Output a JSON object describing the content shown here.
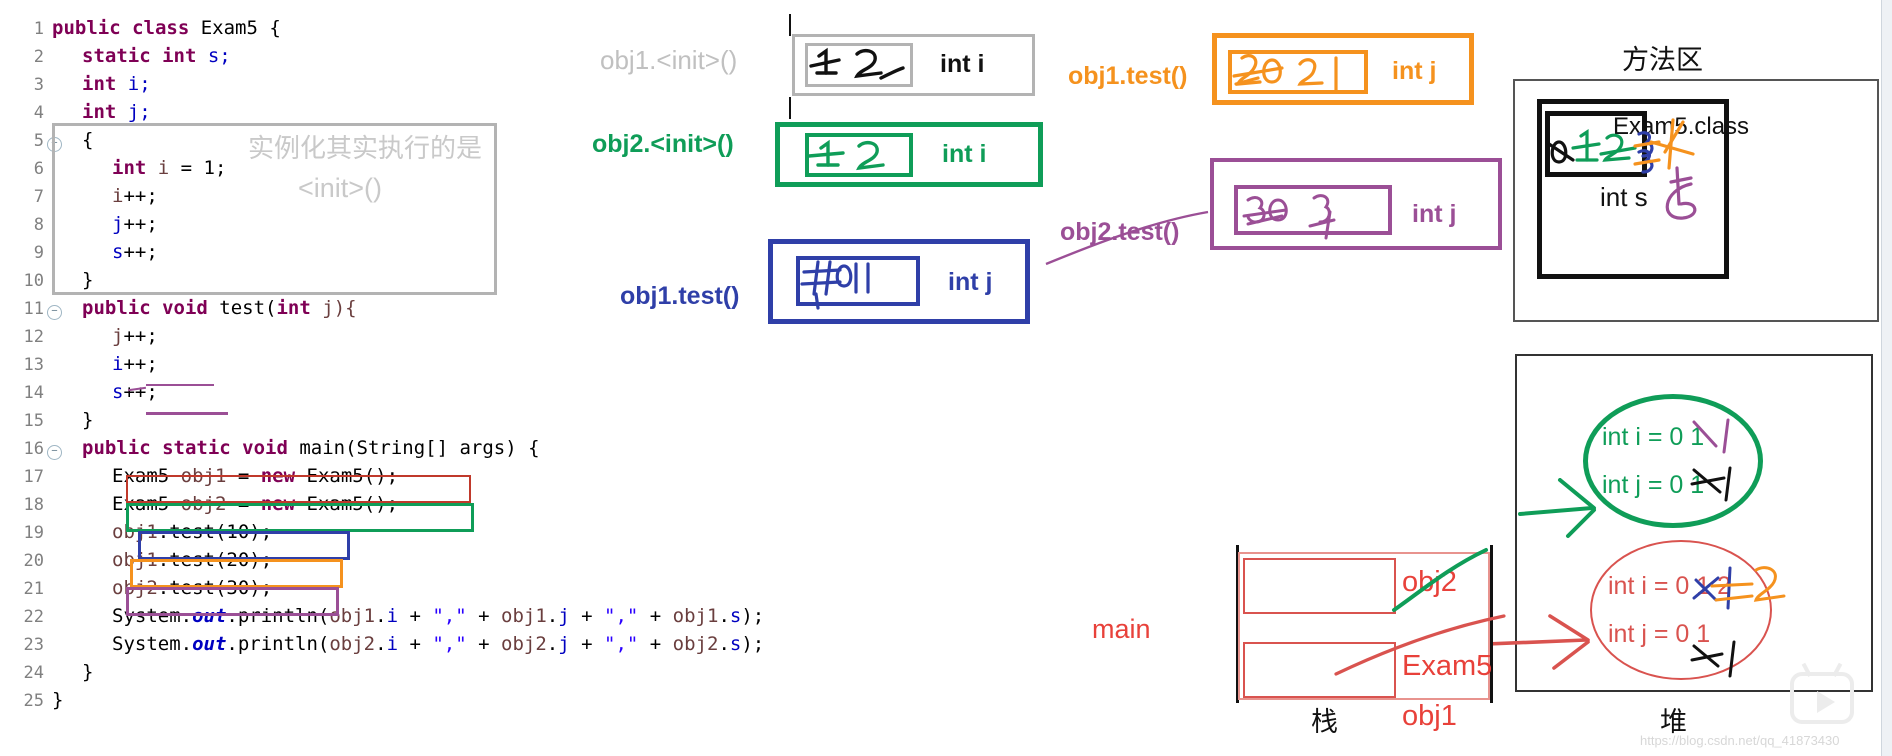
{
  "editor": {
    "lines": [
      {
        "n": "1",
        "indent": 0,
        "segments": [
          {
            "t": "public class ",
            "c": "kw"
          },
          {
            "t": "Exam5 {",
            "c": "plain"
          }
        ]
      },
      {
        "n": "2",
        "indent": 1,
        "segments": [
          {
            "t": "static int ",
            "c": "kw"
          },
          {
            "t": "s;",
            "c": "fld"
          }
        ]
      },
      {
        "n": "3",
        "indent": 1,
        "segments": [
          {
            "t": "int ",
            "c": "kw"
          },
          {
            "t": "i;",
            "c": "fld"
          }
        ]
      },
      {
        "n": "4",
        "indent": 1,
        "segments": [
          {
            "t": "int ",
            "c": "kw"
          },
          {
            "t": "j;",
            "c": "fld"
          }
        ]
      },
      {
        "n": "5",
        "indent": 1,
        "fold": true,
        "segments": [
          {
            "t": "{",
            "c": "plain"
          }
        ]
      },
      {
        "n": "6",
        "indent": 2,
        "segments": [
          {
            "t": "int ",
            "c": "kw"
          },
          {
            "t": "i",
            "c": "loc"
          },
          {
            "t": " = 1;",
            "c": "plain"
          }
        ]
      },
      {
        "n": "7",
        "indent": 2,
        "segments": [
          {
            "t": "i",
            "c": "loc"
          },
          {
            "t": "++;",
            "c": "plain"
          }
        ]
      },
      {
        "n": "8",
        "indent": 2,
        "segments": [
          {
            "t": "j",
            "c": "fld"
          },
          {
            "t": "++;",
            "c": "plain"
          }
        ]
      },
      {
        "n": "9",
        "indent": 2,
        "segments": [
          {
            "t": "s",
            "c": "fld"
          },
          {
            "t": "++;",
            "c": "plain"
          }
        ]
      },
      {
        "n": "10",
        "indent": 1,
        "segments": [
          {
            "t": "}",
            "c": "plain"
          }
        ]
      },
      {
        "n": "11",
        "indent": 1,
        "fold": true,
        "segments": [
          {
            "t": "public void ",
            "c": "kw"
          },
          {
            "t": "test(",
            "c": "plain"
          },
          {
            "t": "int ",
            "c": "kw"
          },
          {
            "t": "j){",
            "c": "loc"
          }
        ]
      },
      {
        "n": "12",
        "indent": 2,
        "segments": [
          {
            "t": "j",
            "c": "loc"
          },
          {
            "t": "++;",
            "c": "plain"
          }
        ]
      },
      {
        "n": "13",
        "indent": 2,
        "segments": [
          {
            "t": "i",
            "c": "fld"
          },
          {
            "t": "++;",
            "c": "plain"
          }
        ]
      },
      {
        "n": "14",
        "indent": 2,
        "segments": [
          {
            "t": "s",
            "c": "fld"
          },
          {
            "t": "++;",
            "c": "plain"
          }
        ]
      },
      {
        "n": "15",
        "indent": 1,
        "segments": [
          {
            "t": "}",
            "c": "plain"
          }
        ]
      },
      {
        "n": "16",
        "indent": 1,
        "fold": true,
        "segments": [
          {
            "t": "public static void ",
            "c": "kw"
          },
          {
            "t": "main(String[] args) {",
            "c": "plain"
          }
        ]
      },
      {
        "n": "17",
        "indent": 2,
        "segments": [
          {
            "t": "Exam5 ",
            "c": "plain"
          },
          {
            "t": "obj1",
            "c": "loc"
          },
          {
            "t": " = ",
            "c": "plain"
          },
          {
            "t": "new ",
            "c": "kw"
          },
          {
            "t": "Exam5();",
            "c": "plain"
          }
        ]
      },
      {
        "n": "18",
        "indent": 2,
        "segments": [
          {
            "t": "Exam5 ",
            "c": "plain"
          },
          {
            "t": "obj2",
            "c": "loc"
          },
          {
            "t": " = ",
            "c": "plain"
          },
          {
            "t": "new ",
            "c": "kw"
          },
          {
            "t": "Exam5();",
            "c": "plain"
          }
        ]
      },
      {
        "n": "19",
        "indent": 2,
        "segments": [
          {
            "t": "obj1",
            "c": "loc"
          },
          {
            "t": ".test(10);",
            "c": "plain"
          }
        ]
      },
      {
        "n": "20",
        "indent": 2,
        "segments": [
          {
            "t": "obj1",
            "c": "loc"
          },
          {
            "t": ".test(20);",
            "c": "plain"
          }
        ]
      },
      {
        "n": "21",
        "indent": 2,
        "segments": [
          {
            "t": "obj2",
            "c": "loc"
          },
          {
            "t": ".test(30);",
            "c": "plain"
          }
        ]
      },
      {
        "n": "22",
        "indent": 2,
        "segments": [
          {
            "t": "System.",
            "c": "plain"
          },
          {
            "t": "out",
            "c": "italicf"
          },
          {
            "t": ".println(",
            "c": "plain"
          },
          {
            "t": "obj1",
            "c": "loc"
          },
          {
            "t": ".",
            "c": "plain"
          },
          {
            "t": "i",
            "c": "fld"
          },
          {
            "t": " + ",
            "c": "plain"
          },
          {
            "t": "\",\"",
            "c": "st"
          },
          {
            "t": " + ",
            "c": "plain"
          },
          {
            "t": "obj1",
            "c": "loc"
          },
          {
            "t": ".",
            "c": "plain"
          },
          {
            "t": "j",
            "c": "fld"
          },
          {
            "t": " + ",
            "c": "plain"
          },
          {
            "t": "\",\"",
            "c": "st"
          },
          {
            "t": " + ",
            "c": "plain"
          },
          {
            "t": "obj1",
            "c": "loc"
          },
          {
            "t": ".",
            "c": "plain"
          },
          {
            "t": "s",
            "c": "fld"
          },
          {
            "t": ");",
            "c": "plain"
          }
        ]
      },
      {
        "n": "23",
        "indent": 2,
        "segments": [
          {
            "t": "System.",
            "c": "plain"
          },
          {
            "t": "out",
            "c": "italicf"
          },
          {
            "t": ".println(",
            "c": "plain"
          },
          {
            "t": "obj2",
            "c": "loc"
          },
          {
            "t": ".",
            "c": "plain"
          },
          {
            "t": "i",
            "c": "fld"
          },
          {
            "t": " + ",
            "c": "plain"
          },
          {
            "t": "\",\"",
            "c": "st"
          },
          {
            "t": " + ",
            "c": "plain"
          },
          {
            "t": "obj2",
            "c": "loc"
          },
          {
            "t": ".",
            "c": "plain"
          },
          {
            "t": "j",
            "c": "fld"
          },
          {
            "t": " + ",
            "c": "plain"
          },
          {
            "t": "\",\"",
            "c": "st"
          },
          {
            "t": " + ",
            "c": "plain"
          },
          {
            "t": "obj2",
            "c": "loc"
          },
          {
            "t": ".",
            "c": "plain"
          },
          {
            "t": "s",
            "c": "fld"
          },
          {
            "t": ");",
            "c": "plain"
          }
        ]
      },
      {
        "n": "24",
        "indent": 1,
        "segments": [
          {
            "t": "}",
            "c": "plain"
          }
        ]
      },
      {
        "n": "25",
        "indent": 0,
        "segments": [
          {
            "t": "}",
            "c": "plain"
          }
        ]
      }
    ],
    "annotations": {
      "ghost_cn": "实例化其实执行的是",
      "ghost_init": "<init>()"
    }
  },
  "diagram": {
    "labels": {
      "obj1_init": "obj1.<init>()",
      "obj2_init": "obj2.<init>()",
      "obj1_test_blue": "obj1.test()",
      "obj1_test_orange": "obj1.test()",
      "obj2_test_purple": "obj2.test()"
    },
    "frames": [
      {
        "name": "obj1-init-frame",
        "type_label": "int i",
        "written": "1 2",
        "color": "#b3b3b3"
      },
      {
        "name": "obj2-init-frame",
        "type_label": "int i",
        "written": "1 2",
        "color": "#0f9d58"
      },
      {
        "name": "obj1-test-blue-frame",
        "type_label": "int j",
        "written": "10 11",
        "color": "#2f3fa8"
      },
      {
        "name": "obj1-test-orange-frame",
        "type_label": "int j",
        "written": "20 21",
        "color": "#f5921e"
      },
      {
        "name": "obj2-test-purple-frame",
        "type_label": "int j",
        "written": "30 31",
        "color": "#9b4f96"
      }
    ]
  },
  "method_area": {
    "title": "方法区",
    "class_label": "Exam5.class",
    "static_field_label": "int s",
    "written_values": "0 1 2 3 4 5"
  },
  "stack": {
    "title": "栈",
    "frame_label": "main",
    "slots": [
      {
        "label": "obj2"
      },
      {
        "label": "Exam5",
        "sub": "obj1"
      }
    ]
  },
  "heap": {
    "title": "堆",
    "objects": [
      {
        "name": "obj2-object",
        "color": "#0f9d58",
        "fields": [
          "int i = 0  1",
          "int j = 0  1"
        ]
      },
      {
        "name": "obj1-object",
        "color": "#d9534f",
        "fields": [
          "int i = 0  1  2",
          "int j = 0  1"
        ]
      }
    ]
  },
  "watermark": {
    "text": "https://blog.csdn.net/qq_41873430"
  }
}
